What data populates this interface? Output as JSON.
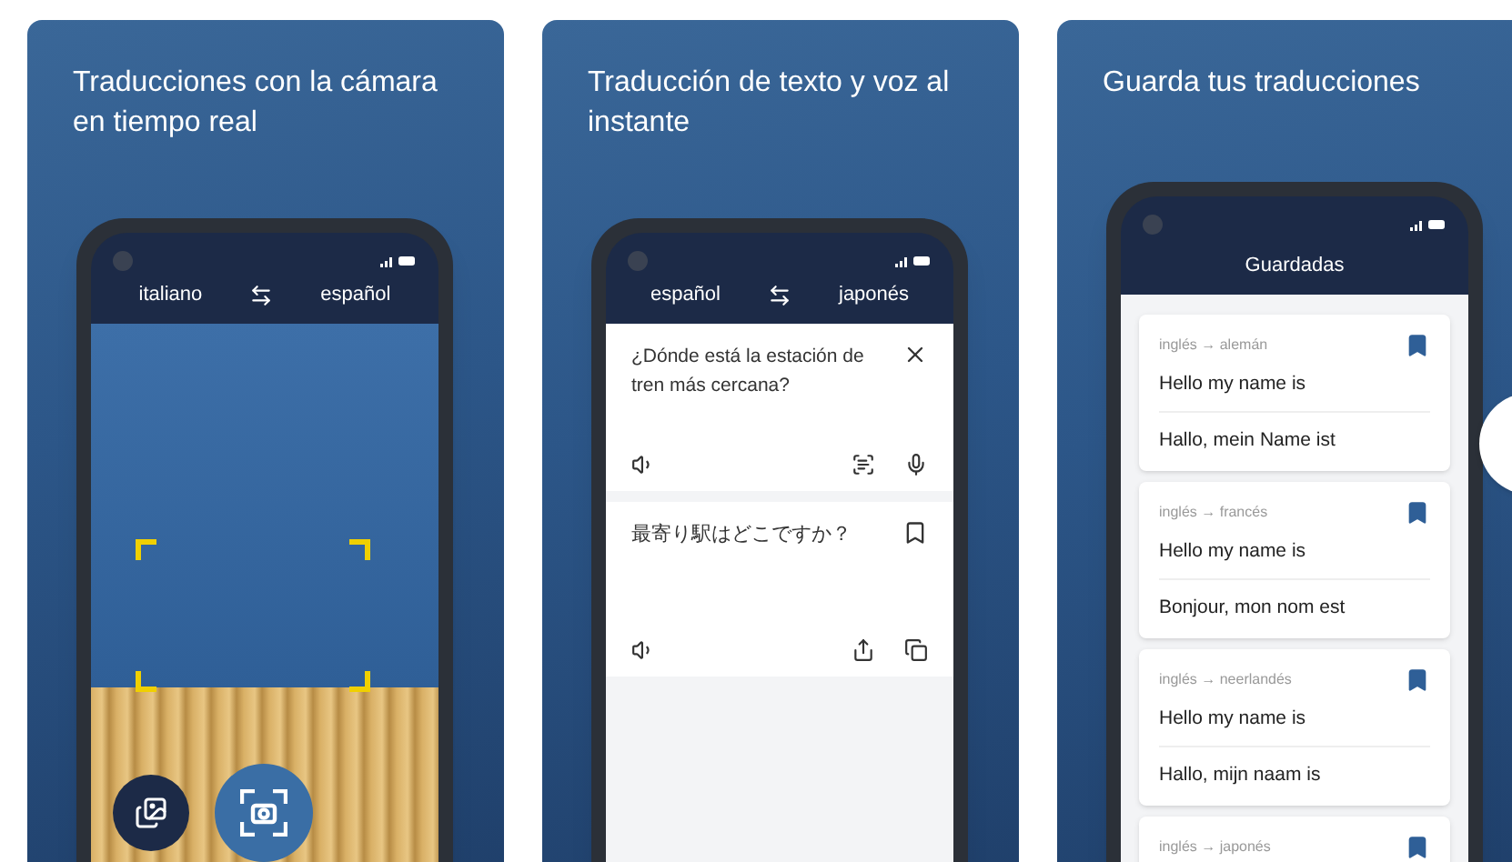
{
  "panels": [
    {
      "kind": "camera",
      "title": "Traducciones con la cámara en tiempo real",
      "source_language": "italiano",
      "target_language": "español"
    },
    {
      "kind": "text",
      "title": "Traducción de texto y voz al instante",
      "source_language": "español",
      "target_language": "japonés",
      "input_text": "¿Dónde está la estación de tren más cercana?",
      "output_text": "最寄り駅はどこですか？",
      "bookmarked": false
    },
    {
      "kind": "saved",
      "title": "Guarda tus traducciones",
      "screen_title": "Guardadas",
      "items": [
        {
          "pair": "inglés → alemán",
          "source": "Hello my name is",
          "translation": "Hallo, mein Name ist",
          "bookmarked": true
        },
        {
          "pair": "inglés → francés",
          "source": "Hello my name is",
          "translation": "Bonjour, mon nom est",
          "bookmarked": true
        },
        {
          "pair": "inglés → neerlandés",
          "source": "Hello my name is",
          "translation": "Hallo, mijn naam is",
          "bookmarked": true
        },
        {
          "pair": "inglés → japonés",
          "bookmarked": true
        }
      ]
    }
  ]
}
